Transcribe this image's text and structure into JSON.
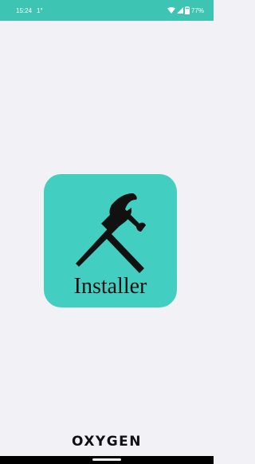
{
  "status_bar": {
    "time": "15:24",
    "temperature": "1°",
    "battery": "77%",
    "background_color": "#3ec4b2",
    "icons": [
      "wifi-icon",
      "signal-icon",
      "battery-icon"
    ]
  },
  "splash": {
    "background_color": "#f2f1f6",
    "app_icon": {
      "label": "Installer",
      "background_color": "#42cfc1",
      "icon": "wrench-hammer-icon"
    },
    "brand": "OXYGEN"
  },
  "navigation_bar": {
    "icon": "home-handle"
  }
}
